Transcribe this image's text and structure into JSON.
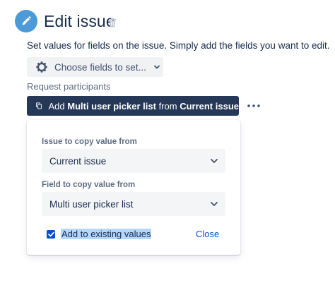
{
  "header": {
    "title": "Edit issue",
    "icon": "pencil-icon",
    "accent_color": "#4c9ad8"
  },
  "description": "Set values for fields on the issue. Simply add the fields you want to edit.",
  "choose_fields": {
    "label": "Choose fields to set...",
    "icon": "gear-icon"
  },
  "request_participants_label": "Request participants",
  "add_action": {
    "prefix": "Add",
    "field": "Multi user picker list",
    "middle": "from",
    "source": "Current issue",
    "icon": "copy-icon",
    "background_color": "#253858"
  },
  "panel": {
    "issue_label": "Issue to copy value from",
    "issue_value": "Current issue",
    "field_label": "Field to copy value from",
    "field_value": "Multi user picker list",
    "checkbox_label": "Add to existing values",
    "checkbox_checked": true,
    "close_label": "Close"
  }
}
